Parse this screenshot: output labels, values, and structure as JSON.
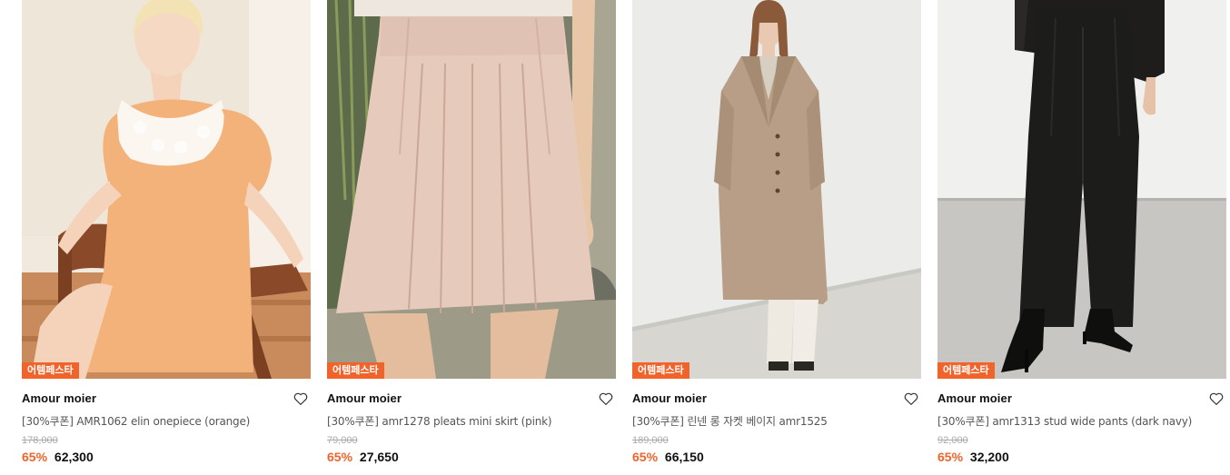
{
  "colors": {
    "badge": "#f0642b",
    "discount": "#f0642b",
    "heart_stroke": "#333333"
  },
  "products": [
    {
      "badge": "어템페스타",
      "brand": "Amour moier",
      "name": "[30%쿠폰] AMR1062 elin onepiece (orange)",
      "original_price": "178,000",
      "discount": "65%",
      "price": "62,300",
      "wish_icon": "heart-outline-icon"
    },
    {
      "badge": "어템페스타",
      "brand": "Amour moier",
      "name": "[30%쿠폰] amr1278 pleats mini skirt (pink)",
      "original_price": "79,000",
      "discount": "65%",
      "price": "27,650",
      "wish_icon": "heart-outline-icon"
    },
    {
      "badge": "어템페스타",
      "brand": "Amour moier",
      "name": "[30%쿠폰] 린넨 롱 자켓 베이지 amr1525",
      "original_price": "189,000",
      "discount": "65%",
      "price": "66,150",
      "wish_icon": "heart-outline-icon"
    },
    {
      "badge": "어템페스타",
      "brand": "Amour moier",
      "name": "[30%쿠폰] amr1313 stud wide pants (dark navy)",
      "original_price": "92,000",
      "discount": "65%",
      "price": "32,200",
      "wish_icon": "heart-outline-icon"
    }
  ]
}
